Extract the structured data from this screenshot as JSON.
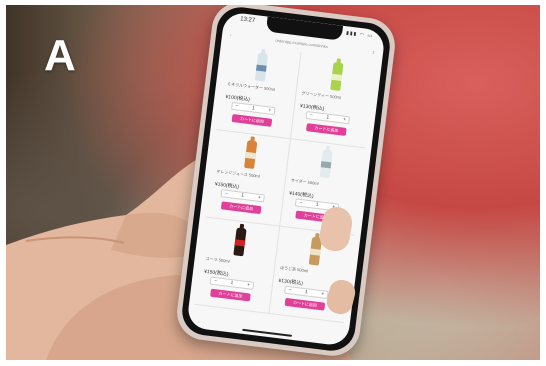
{
  "panel_label": "A",
  "phone": {
    "status_time": "13:27",
    "status_icons": "▮▮▮ ◠ ▭",
    "url": "orderapp.example.com/drinks",
    "back_icon": "chevron-left-icon",
    "share_icon": "share-icon"
  },
  "products": [
    {
      "name": "ミネラルウォーター 500ml",
      "price": "¥100(税込)",
      "qty": "1",
      "add_label": "カートに追加",
      "bottle": "water"
    },
    {
      "name": "グリーンティー 500ml",
      "price": "¥130(税込)",
      "qty": "1",
      "add_label": "カートに追加",
      "bottle": "green"
    },
    {
      "name": "オレンジジュース 500ml",
      "price": "¥150(税込)",
      "qty": "1",
      "add_label": "カートに追加",
      "bottle": "orange"
    },
    {
      "name": "サイダー 500ml",
      "price": "¥140(税込)",
      "qty": "1",
      "add_label": "カートに追加",
      "bottle": "clear"
    },
    {
      "name": "コーラ 500ml",
      "price": "¥150(税込)",
      "qty": "1",
      "add_label": "カートに追加",
      "bottle": "cola"
    },
    {
      "name": "ほうじ茶 500ml",
      "price": "¥130(税込)",
      "qty": "1",
      "add_label": "カートに追加",
      "bottle": "tea"
    }
  ],
  "stepper": {
    "minus": "−",
    "plus": "+"
  },
  "colors": {
    "accent": "#e0409a",
    "background_red": "#c64844"
  }
}
